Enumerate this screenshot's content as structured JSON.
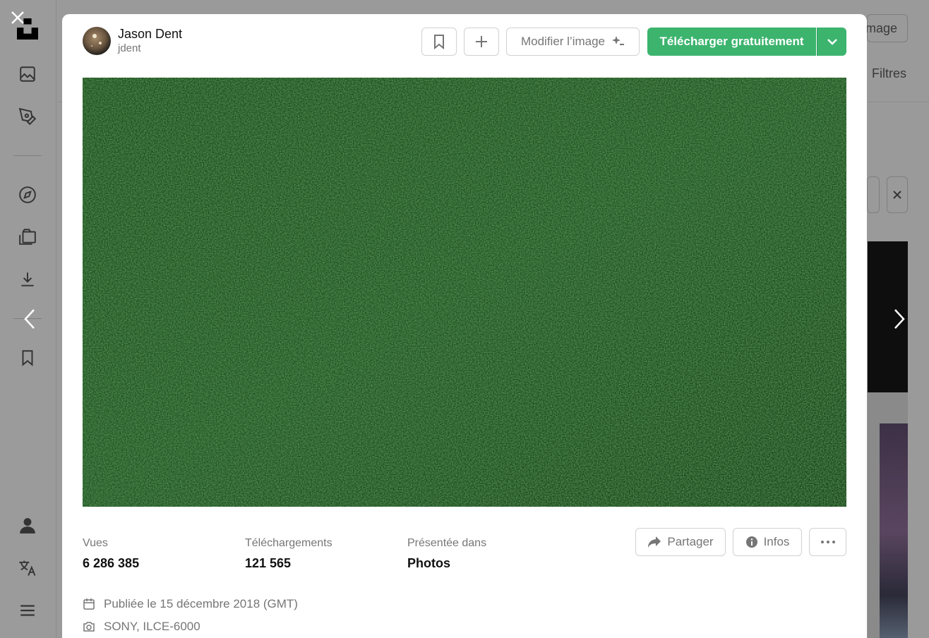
{
  "background": {
    "top_button_label": "Image",
    "filters_label": "Filtres"
  },
  "sidebar": {
    "items": [
      "logo-icon",
      "image-icon",
      "pen-icon",
      "compass-icon",
      "collections-icon",
      "download-icon",
      "bookmark-icon",
      "user-icon",
      "translate-icon",
      "menu-icon"
    ]
  },
  "modal": {
    "author": {
      "name": "Jason Dent",
      "handle": "jdent"
    },
    "toolbar": {
      "edit_label": "Modifier l’image",
      "download_label": "Télécharger gratuitement"
    },
    "photo": {
      "description": "green grass texture"
    },
    "stats": [
      {
        "label": "Vues",
        "value": "6 286 385"
      },
      {
        "label": "Téléchargements",
        "value": "121 565"
      },
      {
        "label": "Présentée dans",
        "value": "Photos"
      }
    ],
    "actions": {
      "share_label": "Partager",
      "info_label": "Infos"
    },
    "meta": {
      "published": "Publiée le 15 décembre 2018 (GMT)",
      "camera": "SONY, ILCE-6000"
    }
  },
  "colors": {
    "accent": "#3cb46e",
    "overlay": "#9a9a9a",
    "muted_text": "#767676"
  }
}
